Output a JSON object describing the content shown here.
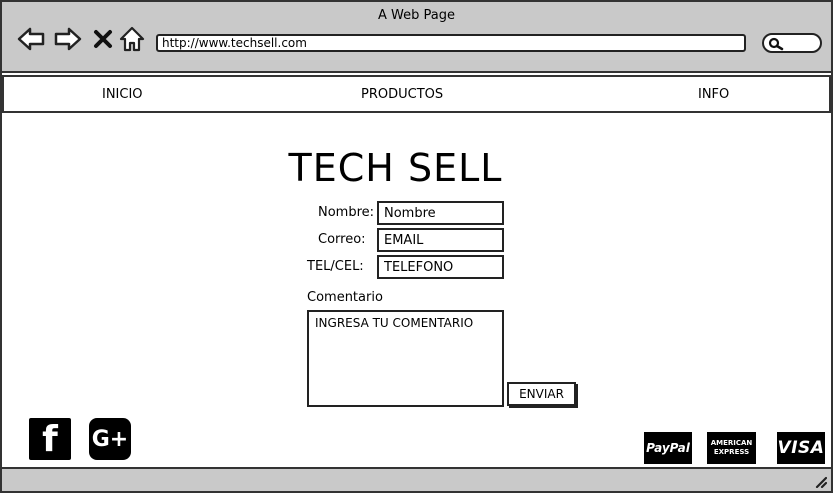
{
  "window": {
    "title": "A Web Page"
  },
  "browser": {
    "url": "http://www.techsell.com",
    "icons": [
      "back-icon",
      "forward-icon",
      "close-icon",
      "home-icon",
      "search-icon"
    ]
  },
  "nav": {
    "items": [
      {
        "label": "INICIO"
      },
      {
        "label": "PRODUCTOS"
      },
      {
        "label": "INFO"
      }
    ]
  },
  "main": {
    "title": "TECH SELL",
    "form": {
      "name_label": "Nombre:",
      "name_value": "Nombre",
      "email_label": "Correo:",
      "email_value": "EMAIL",
      "phone_label": "TEL/CEL:",
      "phone_value": "TELEFONO",
      "comment_label": "Comentario",
      "comment_value": "INGRESA TU COMENTARIO",
      "submit_label": "ENVIAR"
    }
  },
  "footer": {
    "social": [
      {
        "icon": "facebook-icon",
        "glyph": "f"
      },
      {
        "icon": "google-plus-icon",
        "glyph": "G+"
      }
    ],
    "payments": {
      "paypal": "PayPal",
      "amex_line1": "AMERICAN",
      "amex_line2": "EXPRESS",
      "visa": "VISA"
    }
  }
}
